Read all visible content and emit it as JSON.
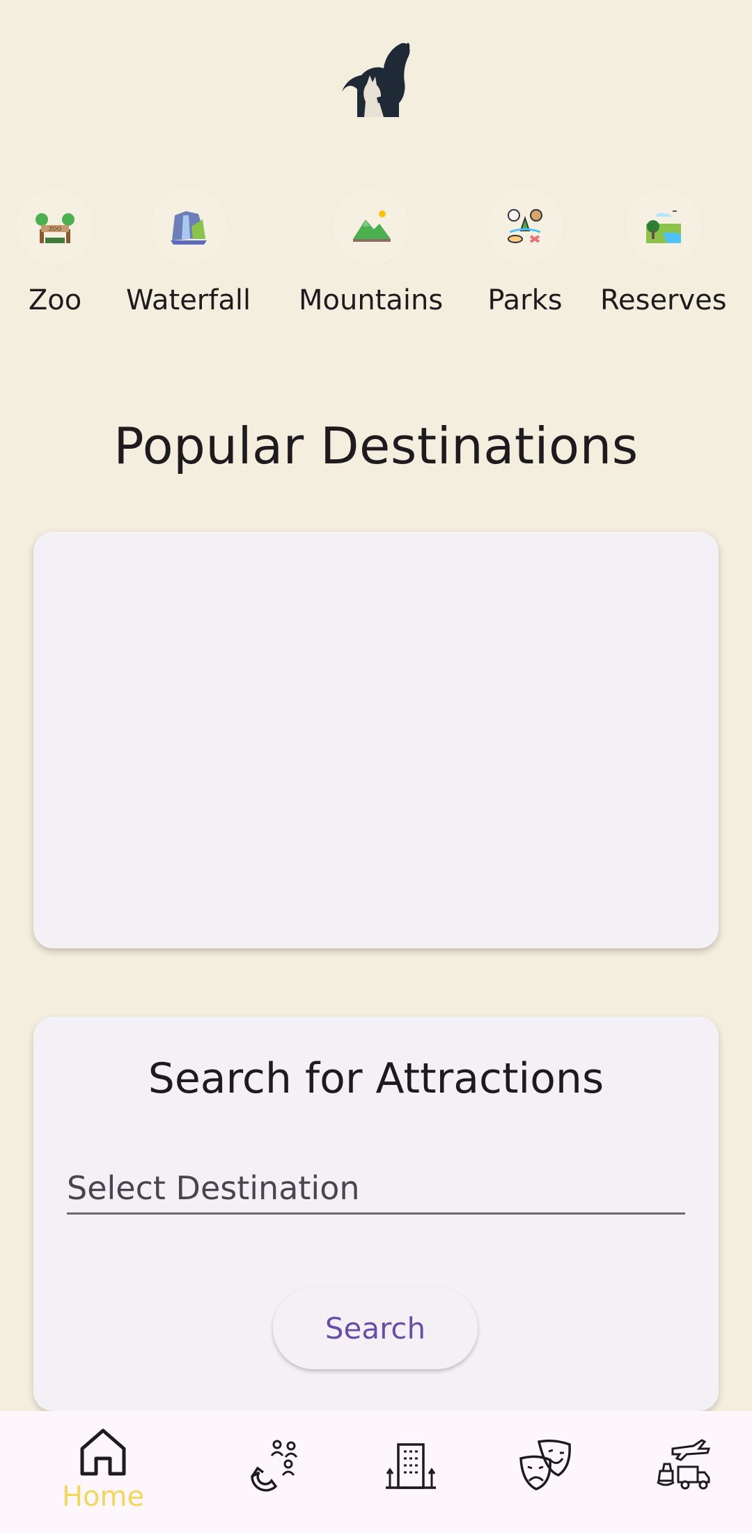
{
  "logo": {
    "icon": "elephant-wolf-logo-icon"
  },
  "categories": [
    {
      "label": "Zoo",
      "icon": "zoo-gate-icon"
    },
    {
      "label": "Waterfall",
      "icon": "waterfall-icon"
    },
    {
      "label": "Mountains",
      "icon": "mountains-icon"
    },
    {
      "label": "Parks",
      "icon": "parks-icon"
    },
    {
      "label": "Reserves",
      "icon": "reserves-icon"
    }
  ],
  "main": {
    "title": "Popular Destinations",
    "search_card": {
      "title": "Search for Attractions",
      "destination_placeholder": "Select Destination",
      "search_button": "Search"
    }
  },
  "bottom_nav": {
    "items": [
      {
        "label": "Home",
        "icon": "home-icon",
        "active": true
      },
      {
        "label": "",
        "icon": "attractions-icon"
      },
      {
        "label": "",
        "icon": "hotel-icon"
      },
      {
        "label": "",
        "icon": "entertainment-icon"
      },
      {
        "label": "",
        "icon": "transport-icon"
      }
    ]
  },
  "colors": {
    "background": "#f4eede",
    "card": "#f4f1f6",
    "accent": "#6a4ea6",
    "active_nav": "#f1d75a"
  }
}
